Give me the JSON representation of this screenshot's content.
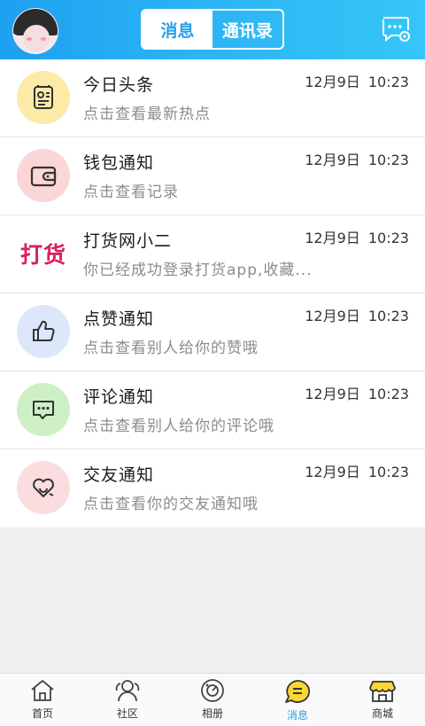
{
  "header": {
    "tab_messages": "消息",
    "tab_contacts": "通讯录",
    "active_tab": "消息",
    "accent_color": "#2BA9F2"
  },
  "messages": [
    {
      "title": "今日头条",
      "subtitle": "点击查看最新热点",
      "time": "12月9日 10:23",
      "icon": "news-icon",
      "icon_bg": "#FBEBA6"
    },
    {
      "title": "钱包通知",
      "subtitle": "点击查看记录",
      "time": "12月9日 10:23",
      "icon": "wallet-icon",
      "icon_bg": "#FBD6D6"
    },
    {
      "title": "打货网小二",
      "subtitle": "你已经成功登录打货app,收藏...",
      "time": "12月9日 10:23",
      "icon": "brand-logo",
      "brand_text": "打货",
      "icon_bg": "#FFFFFF"
    },
    {
      "title": "点赞通知",
      "subtitle": "点击查看别人给你的赞哦",
      "time": "12月9日 10:23",
      "icon": "thumbs-up-icon",
      "icon_bg": "#DCE7FB"
    },
    {
      "title": "评论通知",
      "subtitle": "点击查看别人给你的评论哦",
      "time": "12月9日 10:23",
      "icon": "comment-icon",
      "icon_bg": "#CDEFC5"
    },
    {
      "title": "交友通知",
      "subtitle": "点击查看你的交友通知哦",
      "time": "12月9日 10:23",
      "icon": "friend-heart-icon",
      "icon_bg": "#FBDDE0"
    }
  ],
  "tabbar": {
    "items": [
      {
        "label": "首页",
        "icon": "home-icon"
      },
      {
        "label": "社区",
        "icon": "community-icon"
      },
      {
        "label": "相册",
        "icon": "album-icon"
      },
      {
        "label": "消息",
        "icon": "message-icon",
        "active": true
      },
      {
        "label": "商城",
        "icon": "shop-icon"
      }
    ]
  }
}
